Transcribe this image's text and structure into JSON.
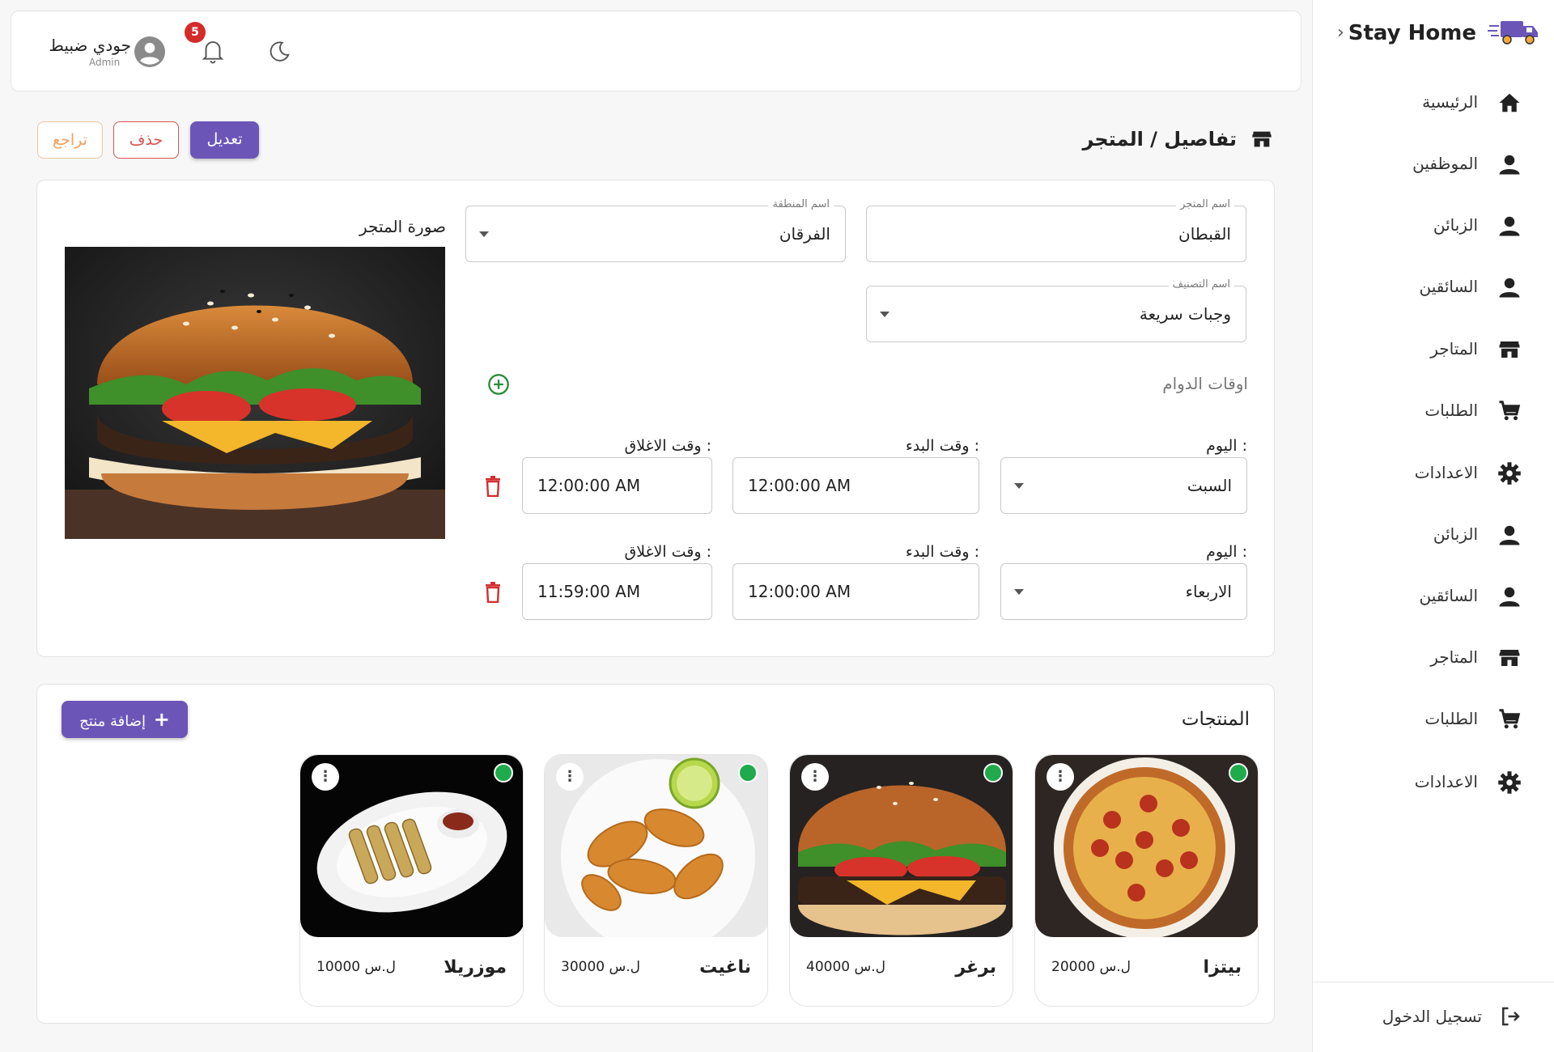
{
  "sidebar": {
    "brand": "Stay Home",
    "items": [
      {
        "label": "الرئيسية",
        "icon": "home-icon"
      },
      {
        "label": "الموظفين",
        "icon": "person-icon"
      },
      {
        "label": "الزبائن",
        "icon": "person-icon"
      },
      {
        "label": "السائقين",
        "icon": "person-icon"
      },
      {
        "label": "المتاجر",
        "icon": "store-icon"
      },
      {
        "label": "الطلبات",
        "icon": "cart-icon"
      },
      {
        "label": "الاعدادات",
        "icon": "gear-icon"
      },
      {
        "label": "الزبائن",
        "icon": "person-icon"
      },
      {
        "label": "السائقين",
        "icon": "person-icon"
      },
      {
        "label": "المتاجر",
        "icon": "store-icon"
      },
      {
        "label": "الطلبات",
        "icon": "cart-icon"
      },
      {
        "label": "الاعدادات",
        "icon": "gear-icon"
      }
    ],
    "logout": "تسجيل الدخول"
  },
  "topbar": {
    "user_name": "جودي ضبيط",
    "user_role": "Admin",
    "notifications": "5"
  },
  "page": {
    "title": "تفاصيل / المتجر",
    "edit": "تعديل",
    "delete": "حذف",
    "back": "تراجع"
  },
  "store": {
    "image_label": "صورة المتجر",
    "name_label": "اسم المتجر",
    "name_value": "القبطان",
    "region_label": "اسم المنطقة",
    "region_value": "الفرقان",
    "category_label": "اسم التصنيف",
    "category_value": "وجبات سريعة",
    "hours_title": "اوقات الدوام",
    "day_label": "اليوم :",
    "start_label": "وقت البدء :",
    "close_label": "وقت الاغلاق :",
    "hours": [
      {
        "day": "السبت",
        "start": "12:00:00 AM",
        "close": "12:00:00 AM"
      },
      {
        "day": "الاربعاء",
        "start": "12:00:00 AM",
        "close": "11:59:00 AM"
      }
    ]
  },
  "products": {
    "title": "المنتجات",
    "add_button": "إضافة منتج",
    "items": [
      {
        "name": "بيتزا",
        "price": "20000 ل.س",
        "image": "pizza"
      },
      {
        "name": "برغر",
        "price": "40000 ل.س",
        "image": "burger"
      },
      {
        "name": "ناغيت",
        "price": "30000 ل.س",
        "image": "nuggets"
      },
      {
        "name": "موزريلا",
        "price": "10000 ل.س",
        "image": "mozzarella-sticks"
      }
    ]
  },
  "colors": {
    "primary": "#6b56b8",
    "danger": "#d9534f",
    "warning": "#f0a060",
    "active": "#1faa4c"
  }
}
